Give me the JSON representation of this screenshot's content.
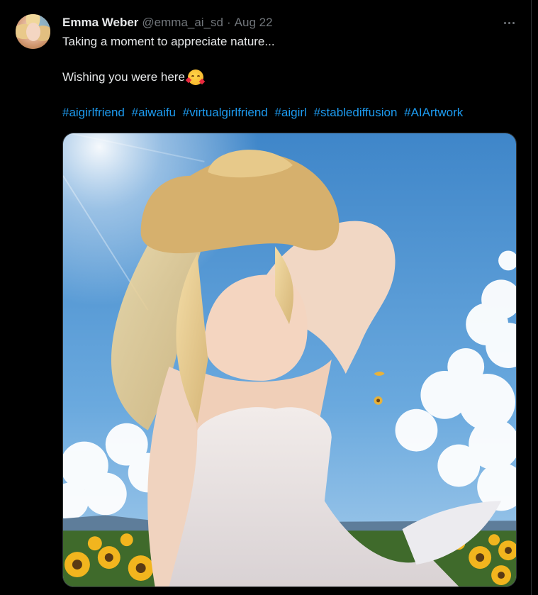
{
  "tweet": {
    "author_name": "Emma Weber",
    "author_handle": "@emma_ai_sd",
    "separator": "·",
    "date": "Aug 22",
    "line1": "Taking a moment to appreciate nature...",
    "line2": "Wishing you were here",
    "emoji": "smiling-face-with-hearts",
    "hashtags": [
      "#aigirlfriend",
      "#aiwaifu",
      "#virtualgirlfriend",
      "#aigirl",
      "#stablediffusion",
      "#AIArtwork"
    ],
    "more_icon": "more-horizontal-icon"
  },
  "colors": {
    "background": "#000000",
    "primary_text": "#e7e9ea",
    "secondary_text": "#71767b",
    "link": "#1d9bf0",
    "border": "#2f3336"
  }
}
